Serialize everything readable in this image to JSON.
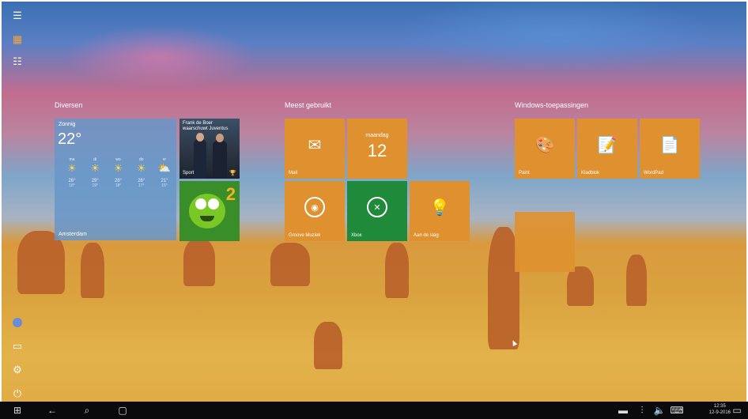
{
  "groups": {
    "diversen": "Diversen",
    "meest": "Meest gebruikt",
    "windows": "Windows-toepassingen"
  },
  "weather": {
    "condition": "Zonnig",
    "temp": "22°",
    "city": "Amsterdam",
    "days": [
      {
        "name": "ma",
        "hi": "26°",
        "lo": "18°"
      },
      {
        "name": "di",
        "hi": "29°",
        "lo": "19°"
      },
      {
        "name": "wo",
        "hi": "28°",
        "lo": "18°"
      },
      {
        "name": "do",
        "hi": "26°",
        "lo": "17°"
      },
      {
        "name": "vr",
        "hi": "21°",
        "lo": "15°"
      }
    ]
  },
  "sport": {
    "headline": "Frank de Boer waarschuwt Juventus",
    "label": "Sport"
  },
  "tiles": {
    "mail": "Mail",
    "cal_day": "maandag",
    "cal_num": "12",
    "groove": "Groove Muziek",
    "xbox": "Xbox",
    "tips": "Aan de slag",
    "paint": "Paint",
    "notepad": "Kladblok",
    "wordpad": "WordPad"
  },
  "clock": {
    "time": "12:35",
    "date": "12-9-2016"
  }
}
